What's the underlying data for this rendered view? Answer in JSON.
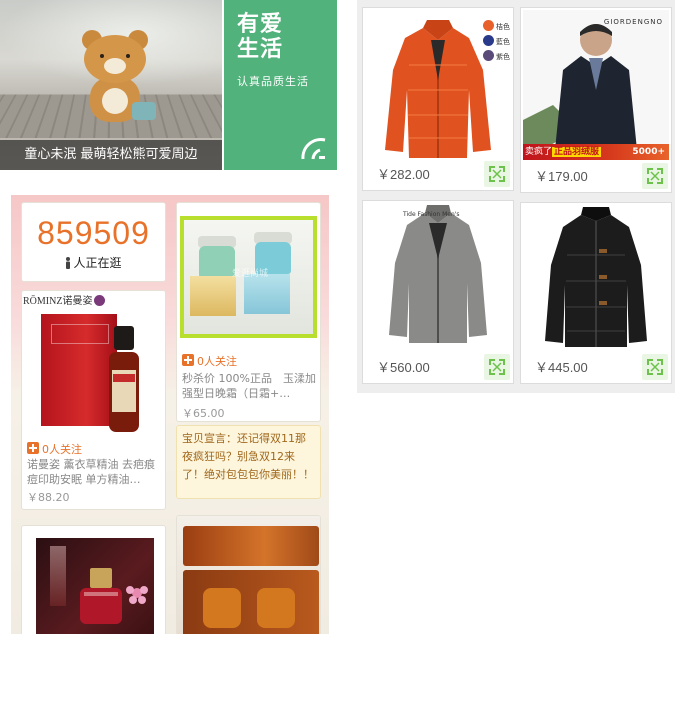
{
  "banner": {
    "caption": "童心未泯 最萌轻松熊可爱周边",
    "side_title_line1": "有爱",
    "side_title_line2": "生活",
    "side_subtitle": "认真品质生活"
  },
  "feed": {
    "counter": {
      "number": "859509",
      "label": "人正在逛"
    },
    "products": [
      {
        "brand": "RŌMINZ诺曼姿",
        "fav": "0人关注",
        "title": "诺曼姿 薰衣草精油 去疤痕痘印助安眠 单方精油…",
        "price": "￥88.20"
      },
      {
        "fav": "0人关注",
        "title": "秒杀价 100%正品　玉渘加强型日晚霜（日霜+…",
        "price": "￥65.00",
        "watermark": "爱逛尚城"
      }
    ],
    "note": "宝贝宣言：还记得双11那夜疯狂吗？别急双12来了！绝对包包包你美丽！！"
  },
  "grid": {
    "items": [
      {
        "price": "￥282.00",
        "swatches": [
          "桔色",
          "藍色",
          "紫色"
        ],
        "swatch_colors": [
          "#e8602a",
          "#2a3a8a",
          "#5a4a7a"
        ]
      },
      {
        "price": "￥179.00",
        "brand": "GIORDENGNO",
        "promo": "卖疯了",
        "promo_tag": "正品羽绒服",
        "promo_num": "5000+"
      },
      {
        "price": "￥560.00",
        "tag": "Tide Fashion Men's"
      },
      {
        "price": "￥445.00"
      }
    ]
  },
  "colors": {
    "accent_orange": "#e8722a",
    "banner_green": "#52b27c",
    "zoom_green": "#6cc24a"
  }
}
